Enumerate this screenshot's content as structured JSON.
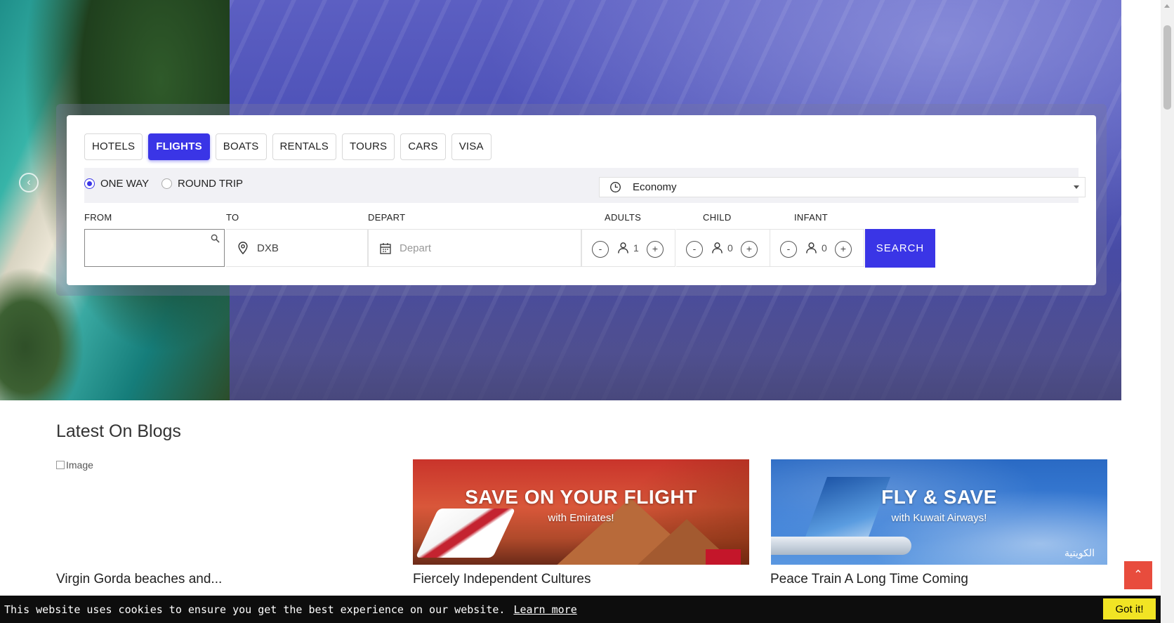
{
  "hero": {
    "prev_arrow": "‹",
    "next_arrow": "›"
  },
  "search": {
    "tabs": [
      {
        "label": "HOTELS",
        "active": false
      },
      {
        "label": "FLIGHTS",
        "active": true
      },
      {
        "label": "BOATS",
        "active": false
      },
      {
        "label": "RENTALS",
        "active": false
      },
      {
        "label": "TOURS",
        "active": false
      },
      {
        "label": "CARS",
        "active": false
      },
      {
        "label": "VISA",
        "active": false
      }
    ],
    "trip_type": {
      "one_way": "ONE WAY",
      "round_trip": "ROUND TRIP",
      "selected": "one_way"
    },
    "cabin_class": "Economy",
    "labels": {
      "from": "FROM",
      "to": "TO",
      "depart": "DEPART",
      "adults": "ADULTS",
      "child": "CHILD",
      "infant": "INFANT"
    },
    "from_value": "",
    "to_value": "DXB",
    "depart_placeholder": "Depart",
    "adults": "1",
    "child": "0",
    "infant": "0",
    "minus": "-",
    "plus": "+",
    "submit": "SEARCH",
    "accent_color": "#3a35e6"
  },
  "blogs": {
    "heading": "Latest On Blogs",
    "broken_image_alt": "Image",
    "posts": [
      {
        "title": "Virgin Gorda beaches and..."
      },
      {
        "title": "Fiercely Independent Cultures",
        "banner_headline": "SAVE ON YOUR FLIGHT",
        "banner_sub": "with Emirates!"
      },
      {
        "title": "Peace Train A Long Time Coming",
        "banner_headline": "FLY & SAVE",
        "banner_sub": "with Kuwait Airways!"
      }
    ],
    "kuwait_logo_text": "الكويتية"
  },
  "cookie": {
    "message": "This website uses cookies to ensure you get the best experience on our website.",
    "learn_more": "Learn more",
    "accept": "Got it!"
  },
  "back_to_top": "⌃"
}
